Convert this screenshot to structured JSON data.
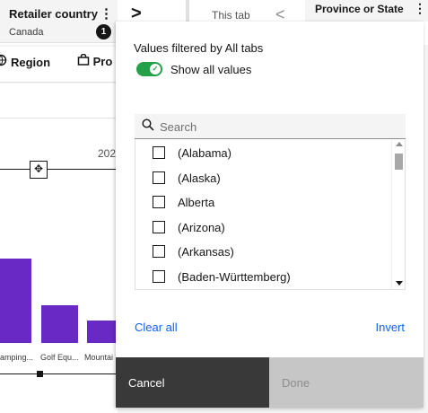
{
  "background": {
    "filter_chip": {
      "title": "Retailer country",
      "value": "Canada",
      "count_badge": "1"
    },
    "next_tabs_icon": "chevron-right-icon",
    "tab": {
      "label": "This tab",
      "scroll_icon": "chevron-left-icon"
    },
    "province_chip": {
      "title": "Province or State"
    },
    "toolbar": {
      "region_label": "Region",
      "product_label": "Pro"
    },
    "chart": {
      "year_label": "202",
      "category_labels": [
        "amping...",
        "Golf Equ...",
        "Mountai"
      ]
    }
  },
  "panel": {
    "filtered_by_label": "Values filtered by All tabs",
    "show_all_toggle": {
      "label": "Show all values",
      "on": true,
      "color": "#24a148"
    },
    "search": {
      "placeholder": "Search",
      "value": ""
    },
    "values": [
      {
        "label": "(Alabama)",
        "checked": false
      },
      {
        "label": "(Alaska)",
        "checked": false
      },
      {
        "label": "Alberta",
        "checked": false
      },
      {
        "label": "(Arizona)",
        "checked": false
      },
      {
        "label": "(Arkansas)",
        "checked": false
      },
      {
        "label": "(Baden-Württemberg)",
        "checked": false
      }
    ],
    "clear_all_label": "Clear all",
    "invert_label": "Invert",
    "cancel_label": "Cancel",
    "done_label": "Done",
    "colors": {
      "link": "#0f62fe",
      "bar": "#6929c4",
      "cancel_bg": "#393939",
      "done_bg": "#c6c6c6"
    }
  }
}
